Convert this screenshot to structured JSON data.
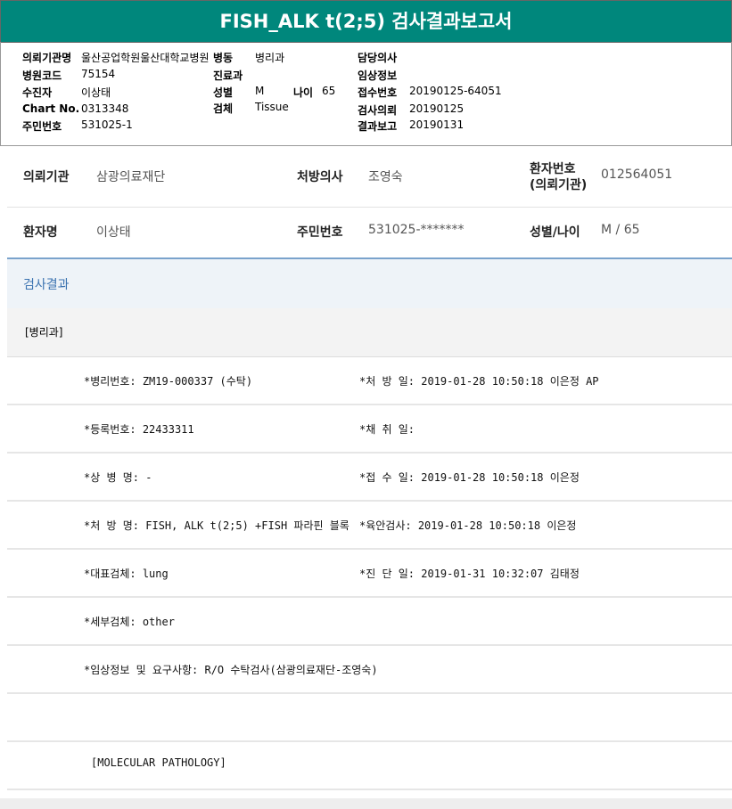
{
  "title": "FISH_ALK t(2;5) 검사결과보고서",
  "info": {
    "inst_label": "의뢰기관명",
    "inst": "울산공업학원울산대학교병원",
    "ward_label": "병동",
    "ward": "병리과",
    "doctor_label": "담당의사",
    "code_label": "병원코드",
    "code": "75154",
    "dept_label": "진료과",
    "clinical_label": "임상정보",
    "patient_label": "수진자",
    "patient": "이상태",
    "sex_label": "성별",
    "sex": "M",
    "age_label": "나이",
    "age": "65",
    "receipt_label": "접수번호",
    "receipt": "20190125-64051",
    "chart_label": "Chart No.",
    "chart": "0313348",
    "specimen_label": "검체",
    "specimen": "Tissue",
    "request_label": "검사의뢰",
    "request": "20190125",
    "rrn_label": "주민번호",
    "rrn": "531025-1",
    "report_label": "결과보고",
    "report": "20190131"
  },
  "patient": {
    "inst_label": "의뢰기관",
    "inst": "삼광의료재단",
    "doctor_label": "처방의사",
    "doctor": "조영숙",
    "pid_label1": "환자번호",
    "pid_label2": "(의뢰기관)",
    "pid": "012564051",
    "name_label": "환자명",
    "name": "이상태",
    "rrn_label": "주민번호",
    "rrn": "531025-*******",
    "sexage_label": "성별/나이",
    "sexage": "M / 65"
  },
  "section": "검사결과",
  "dept": "[병리과]",
  "rows": [
    [
      "*병리번호: ZM19-000337 (수탁)",
      "*처 방 일: 2019-01-28 10:50:18  이은정 AP"
    ],
    [
      "*등록번호: 22433311",
      "*채 취 일:"
    ],
    [
      "*상 병 명: -",
      "*접 수 일: 2019-01-28 10:50:18  이은정"
    ],
    [
      "*처 방 명: FISH, ALK t(2;5) +FISH 파라핀 블록",
      "*육안검사: 2019-01-28 10:50:18  이은정"
    ],
    [
      "*대표검체: lung",
      "*진 단 일: 2019-01-31 10:32:07  김태정"
    ],
    [
      "*세부검체: other",
      ""
    ],
    [
      "*임상정보 및 요구사항: R/O 수탁검사(삼광의료재단-조영숙)",
      ""
    ],
    [
      "",
      ""
    ]
  ],
  "molecular": "[MOLECULAR PATHOLOGY]"
}
